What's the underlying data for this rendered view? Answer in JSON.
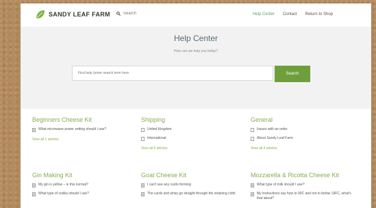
{
  "header": {
    "logo_text": "SANDY LEAF FARM",
    "search_placeholder": "Search",
    "nav": [
      "Help Center",
      "Contact",
      "Return to Shop"
    ]
  },
  "hero": {
    "title": "Help Center",
    "subtitle": "How can we help you today?",
    "search_placeholder": "Find help (enter search term here",
    "search_button": "Search"
  },
  "colors": {
    "accent": "#6e9f3c",
    "category_title": "#86ad55",
    "hero_bg": "#f2f2f2"
  },
  "categories": [
    {
      "title": "Beginners Cheese Kit",
      "items": [
        "What microwave power setting should I use?"
      ],
      "view_all": "View all 1 articles"
    },
    {
      "title": "Shipping",
      "items": [
        "United Kingdom",
        "International"
      ],
      "view_all": "View all 6 articles"
    },
    {
      "title": "General",
      "items": [
        "Issues with an order",
        "About Sandy Leaf Farm"
      ],
      "view_all": "View all 4 articles"
    },
    {
      "title": "Gin Making Kit",
      "items": [
        "My gin is yellow – is this normal?",
        "What type of vodka should I use?"
      ]
    },
    {
      "title": "Goat Cheese Kit",
      "items": [
        "I can't see any curds forming",
        "The curds and whey go straight through the straining cloth"
      ]
    },
    {
      "title": "Mozzarella & Ricotta Cheese Kit",
      "items": [
        "What type of milk should I use?",
        "My instructions say how to 90C and not to below 19FC, what's that about?"
      ]
    }
  ]
}
